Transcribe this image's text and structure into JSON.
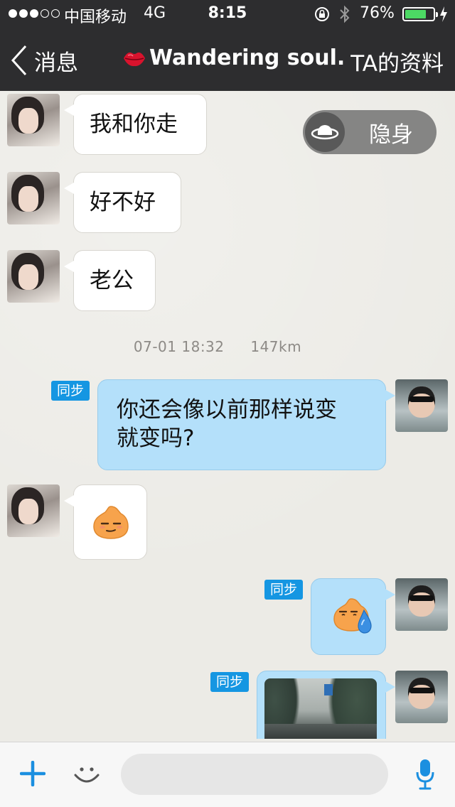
{
  "status_bar": {
    "carrier": "中国移动",
    "network": "4G",
    "time": "8:15",
    "battery_percent": "76%",
    "battery_level": 0.76,
    "signal_bars_filled": 3,
    "signal_bars_total": 5
  },
  "nav": {
    "back_label": "消息",
    "title": "Wandering soul.",
    "profile_label": "TA的资料"
  },
  "incognito": {
    "label": "隐身"
  },
  "messages": [
    {
      "side": "left",
      "text": "我和你走"
    },
    {
      "side": "left",
      "text": "好不好"
    },
    {
      "side": "left",
      "text": "老公"
    },
    {
      "side": "right",
      "sync": "同步",
      "lines": [
        "你还会像以前那样说变",
        "就变吗?"
      ]
    },
    {
      "side": "left",
      "emoji": "smirk-face"
    },
    {
      "side": "right",
      "sync": "同步",
      "emoji": "sweat-face"
    },
    {
      "side": "right",
      "sync": "同步",
      "image": "street-photo"
    }
  ],
  "timestamp": {
    "date_time": "07-01 18:32",
    "distance": "147km"
  },
  "input_bar": {
    "placeholder": ""
  },
  "colors": {
    "nav_bg": "#2d2d2f",
    "chat_bg": "#ecebe6",
    "bubble_left": "#ffffff",
    "bubble_right": "#b4e0fa",
    "sync_badge": "#1596e2",
    "accent": "#1b8fe0",
    "battery_fill": "#4cd964"
  }
}
